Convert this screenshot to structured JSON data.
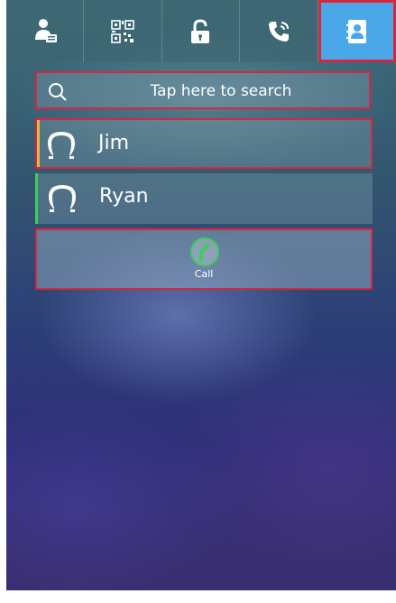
{
  "tabs": [
    {
      "icon": "contacts-person-icon"
    },
    {
      "icon": "qr-code-icon"
    },
    {
      "icon": "unlock-icon"
    },
    {
      "icon": "phone-call-icon"
    },
    {
      "icon": "address-book-icon",
      "active": true
    }
  ],
  "search": {
    "placeholder": "Tap here to search"
  },
  "contacts": [
    {
      "name": "Jim"
    },
    {
      "name": "Ryan"
    }
  ],
  "call": {
    "label": "Call"
  },
  "colors": {
    "active_tab": "#4aa8e8",
    "highlight_border": "#d7263d",
    "call_green": "#3ecf5a"
  }
}
